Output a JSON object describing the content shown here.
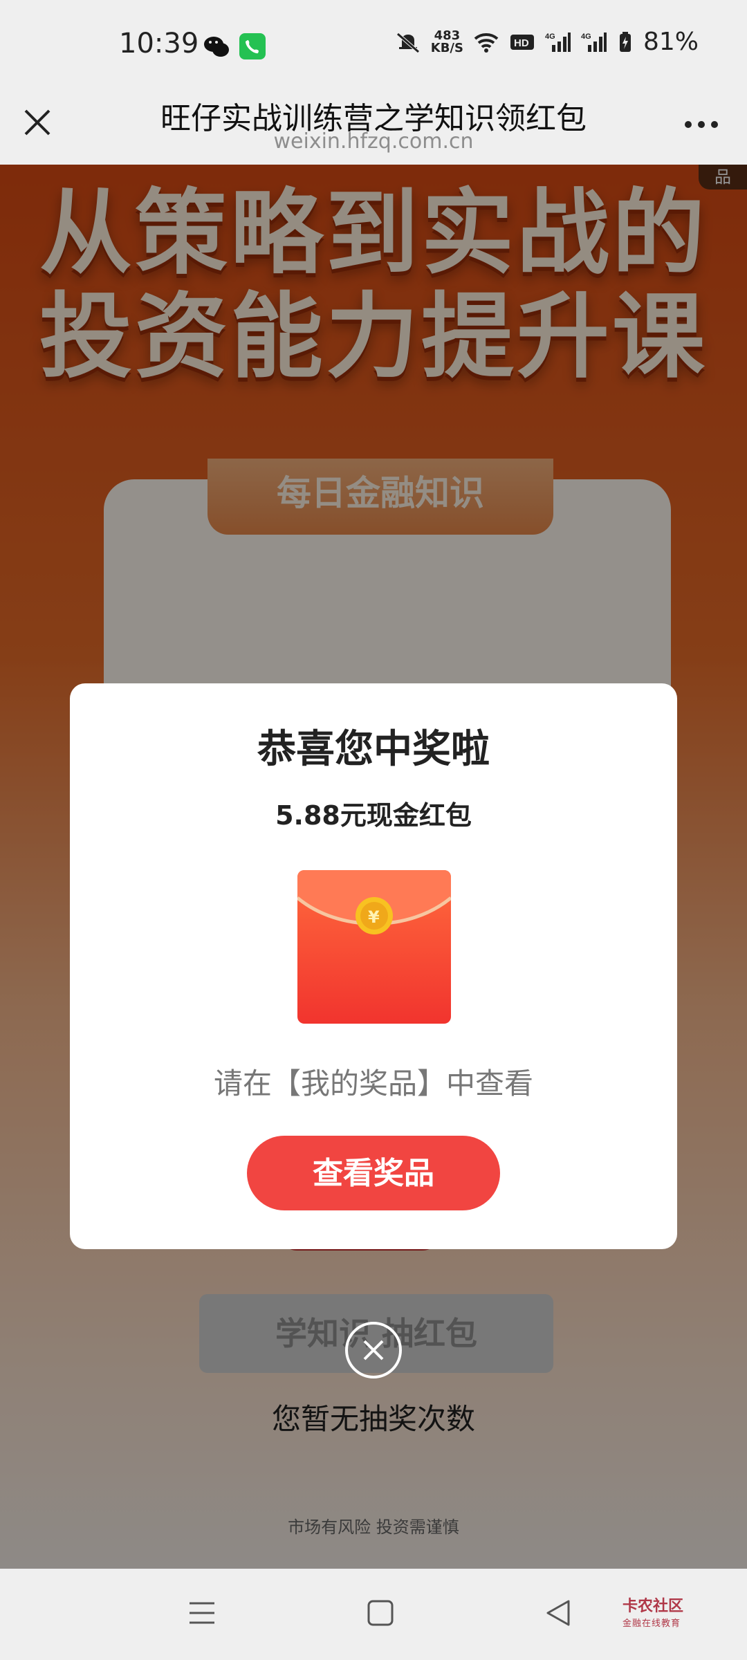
{
  "status_bar": {
    "time": "10:39",
    "net_speed": "483",
    "net_speed_unit": "KB/S",
    "battery": "81%"
  },
  "header": {
    "title": "旺仔实战训练营之学知识领红包",
    "url": "weixin.hfzq.com.cn"
  },
  "page": {
    "hero_line_1": "从策略到实战的",
    "hero_line_2": "投资能力提升课",
    "corner_tag": "品",
    "ribbon_text": "每日金融知识",
    "draw_button": "学知识 抽红包",
    "no_draws_text": "您暂无抽奖次数",
    "risk_text": "市场有风险 投资需谨慎"
  },
  "modal": {
    "title": "恭喜您中奖啦",
    "prize": "5.88元现金红包",
    "hint": "请在【我的奖品】中查看",
    "button": "查看奖品"
  },
  "watermark": {
    "main": "卡农社区",
    "sub": "金融在线教育"
  },
  "colors": {
    "accent": "#f14541",
    "hero_bg": "#d94a13",
    "call_green": "#24c152"
  }
}
